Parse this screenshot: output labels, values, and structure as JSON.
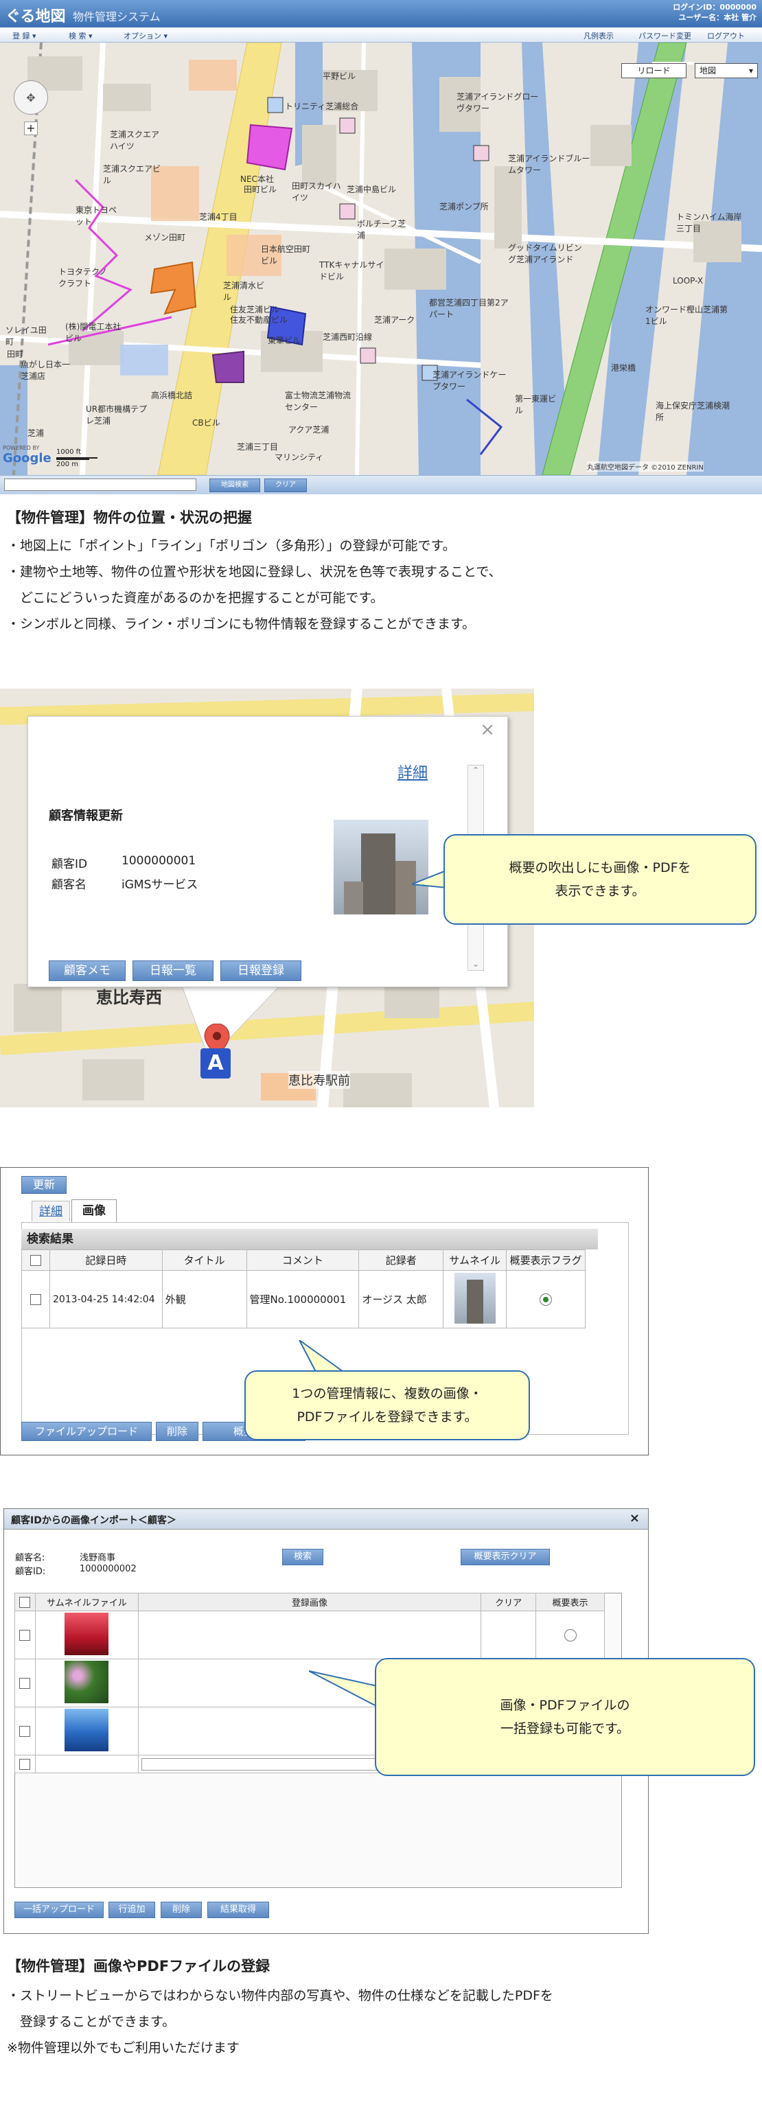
{
  "app": {
    "logo": "ぐる地図",
    "system_name": "物件管理システム",
    "login_id_label": "ログインID：",
    "login_id": "0000000",
    "user_label": "ユーザー名：",
    "user_name": "本社 管介"
  },
  "menu": {
    "items": [
      "登 録",
      "検 索",
      "オプション"
    ],
    "right": [
      "凡例表示",
      "パスワード変更",
      "ログアウト"
    ]
  },
  "map": {
    "reload_label": "リロード",
    "type_select": "地図",
    "scale_ft": "1000 ft",
    "scale_m": "200 m",
    "copyright": "丸運航空地図データ ©2010 ZENRIN",
    "search_btn": "地図検索",
    "clear_btn": "クリア",
    "google": "Google",
    "powered_by": "POWERED BY",
    "labels": [
      "トリニティ芝浦総合",
      "平野ビル",
      "芝浦アイランドグローヴタワー",
      "芝浦スクエアハイツ",
      "芝浦スクエアビル",
      "NEC本社",
      "田町ビル",
      "田町スカイハイツ",
      "東京トヨペット",
      "メゾン田町",
      "芝浦4丁目",
      "芝浦中島ビル",
      "ボルチーフ芝浦",
      "芝浦アイランドブルームタワー",
      "芝浦ポンプ所",
      "グッドタイムリビング芝浦アイランド",
      "トミンハイム海岸三丁目",
      "LOOP-X",
      "トヨタテクノクラフト",
      "日本航空田町ビル",
      "TTKキャナルサイドビル",
      "芝浦清水ビル",
      "都営芝浦四丁目第2アパート",
      "芝浦アーク",
      "オンワード樫山芝浦第1ビル",
      "(株)関電工本社ビル",
      "住友芝浦ビル",
      "住友不動産ビル",
      "東華ビル",
      "芝浦西町沿線",
      "港栄橋",
      "芝浦アイランドケープタワー",
      "UR都市機構テプレ芝浦",
      "高浜橋北詰",
      "CBビル",
      "富士物流芝浦物流センター",
      "第一東運ビル",
      "海上保安庁芝浦検潮所",
      "魚がし日本一芝浦店",
      "ソレイユ田町",
      "アクア芝浦",
      "マリンシティ",
      "芝浦三丁目",
      "芝浦",
      "田町"
    ]
  },
  "section1": {
    "title": "【物件管理】物件の位置・状況の把握",
    "lines": [
      "・地図上に「ポイント」「ライン」「ポリゴン（多角形）」の登録が可能です。",
      "・建物や土地等、物件の位置や形状を地図に登録し、状況を色等で表現することで、",
      "　どこにどういった資産があるのかを把握することが可能です。",
      "・シンボルと同様、ライン・ポリゴンにも物件情報を登録することができます。"
    ]
  },
  "popup": {
    "title": "顧客情報更新",
    "detail_link": "詳細",
    "close": "×",
    "id_label": "顧客ID",
    "id_value": "1000000001",
    "name_label": "顧客名",
    "name_value": "iGMSサービス",
    "buttons": [
      "顧客メモ",
      "日報一覧",
      "日報登録"
    ],
    "place": "恵比寿西",
    "station": "恵比寿駅前",
    "marker_letter": "A",
    "callout_lines": [
      "概要の吹出しにも画像・PDFを",
      "表示できます。"
    ]
  },
  "panel3": {
    "update_btn": "更新",
    "tabs": [
      "詳細",
      "画像"
    ],
    "results_title": "検索結果",
    "columns": [
      "記録日時",
      "タイトル",
      "コメント",
      "記録者",
      "サムネイル",
      "概要表示フラグ"
    ],
    "rows": [
      {
        "datetime": "2013-04-25 14:42:04",
        "title": "外観",
        "comment": "管理No.100000001",
        "recorder": "オージス 太郎"
      }
    ],
    "footer_buttons": [
      "ファイルアップロード",
      "削除",
      "概要表示"
    ],
    "callout_lines": [
      "1つの管理情報に、複数の画像・",
      "PDFファイルを登録できます。"
    ]
  },
  "panel4": {
    "title": "顧客IDからの画像インポート＜顧客＞",
    "close": "×",
    "name_label": "顧客名:",
    "name_value": "浅野商事",
    "id_label": "顧客ID:",
    "id_value": "1000000002",
    "search_btn": "検索",
    "clear_btn": "概要表示クリア",
    "columns": [
      "サムネイルファイル",
      "登録画像",
      "クリア",
      "概要表示"
    ],
    "footer_buttons": [
      "一括アップロード",
      "行追加",
      "削除",
      "結果取得"
    ],
    "callout_lines": [
      "画像・PDFファイルの",
      "一括登録も可能です。"
    ]
  },
  "section2": {
    "title": "【物件管理】画像やPDFファイルの登録",
    "lines": [
      "・ストリートビューからではわからない物件内部の写真や、物件の仕様などを記載したPDFを",
      "　登録することができます。",
      "※物件管理以外でもご利用いただけます"
    ]
  }
}
